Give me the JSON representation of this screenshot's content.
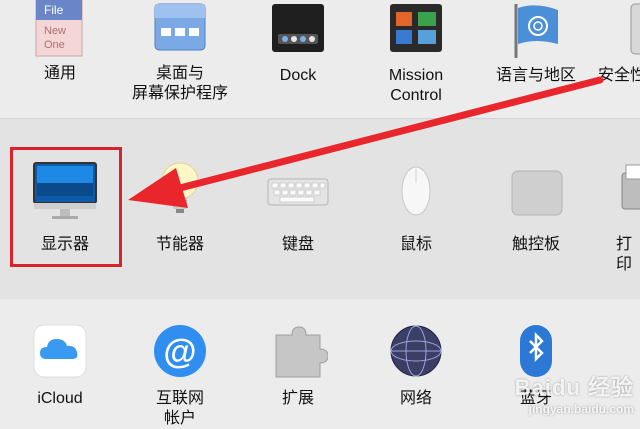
{
  "row1": [
    {
      "label": "通用"
    },
    {
      "label": "桌面与\n屏幕保护程序"
    },
    {
      "label": "Dock"
    },
    {
      "label": "Mission\nControl"
    },
    {
      "label": "语言与地区"
    },
    {
      "label": "安全性"
    }
  ],
  "row1_general_icon_texts": [
    "File",
    "New",
    "One"
  ],
  "row2": [
    {
      "label": "显示器"
    },
    {
      "label": "节能器"
    },
    {
      "label": "键盘"
    },
    {
      "label": "鼠标"
    },
    {
      "label": "触控板"
    },
    {
      "label": "打印"
    }
  ],
  "row3": [
    {
      "label": "iCloud"
    },
    {
      "label": "互联网\n帐户"
    },
    {
      "label": "扩展"
    },
    {
      "label": "网络"
    },
    {
      "label": "蓝牙"
    }
  ],
  "annotation": {
    "highlight_color": "#d8232a",
    "arrow_color": "#e8262c"
  },
  "watermark": {
    "text": "Baidu 经验",
    "sub": "jingyan.baidu.com"
  }
}
